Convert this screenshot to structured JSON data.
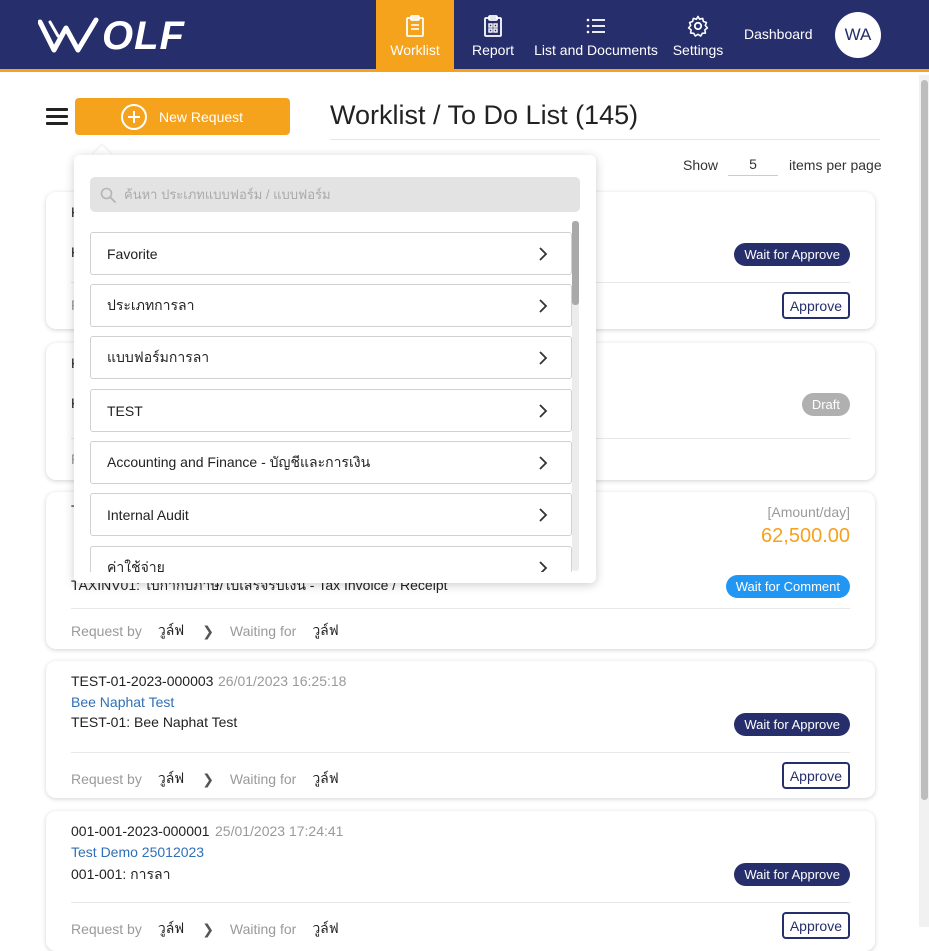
{
  "app": {
    "logo_text": "OLF",
    "logo_alt": "WOLF"
  },
  "nav": {
    "items": [
      {
        "label": "Worklist"
      },
      {
        "label": "Report"
      },
      {
        "label": "List and Documents"
      },
      {
        "label": "Settings"
      }
    ],
    "dashboard": "Dashboard",
    "avatar_initials": "WA"
  },
  "toolbar": {
    "new_request_label": "New Request"
  },
  "page": {
    "title": "Worklist / To Do List (145)",
    "show_label": "Show",
    "items_per_page": "5",
    "items_per_page_suffix": "items per page"
  },
  "dropdown": {
    "search_placeholder": "ค้นหา ประเภทแบบฟอร์ม / แบบฟอร์ม",
    "items": [
      {
        "label": "Favorite"
      },
      {
        "label": "ประเภทการลา"
      },
      {
        "label": "แบบฟอร์มการลา"
      },
      {
        "label": "TEST"
      },
      {
        "label": "Accounting and Finance - บัญชีและการเงิน"
      },
      {
        "label": "Internal Audit"
      },
      {
        "label": "ค่าใช้จ่าย"
      }
    ]
  },
  "cards": [
    {
      "doc_no": "K",
      "partial": "K",
      "foot_partial": "F",
      "status": "Wait for Approve",
      "action": "Approve"
    },
    {
      "doc_no": "K",
      "partial": "K",
      "foot_partial": "F",
      "status": "Draft"
    },
    {
      "doc_no": "T",
      "subtitle": "TAXINV01: ใบกำกับภาษี/ใบเสร็จรับเงิน - Tax Invoice / Receipt",
      "amount_label": "[Amount/day]",
      "amount": "62,500.00",
      "status": "Wait for Comment",
      "request_by_label": "Request by",
      "request_by": "วูล์ฟ",
      "waiting_for_label": "Waiting for",
      "waiting_for": "วูล์ฟ"
    },
    {
      "doc_no": "TEST-01-2023-000003",
      "date": "26/01/2023 16:25:18",
      "link": "Bee Naphat Test",
      "subtitle": "TEST-01: Bee Naphat Test",
      "status": "Wait for Approve",
      "action": "Approve",
      "request_by_label": "Request by",
      "request_by": "วูล์ฟ",
      "waiting_for_label": "Waiting for",
      "waiting_for": "วูล์ฟ"
    },
    {
      "doc_no": "001-001-2023-000001",
      "date": "25/01/2023 17:24:41",
      "link": "Test Demo 25012023",
      "subtitle": "001-001: การลา",
      "status": "Wait for Approve",
      "action": "Approve",
      "request_by_label": "Request by",
      "request_by": "วูล์ฟ",
      "waiting_for_label": "Waiting for",
      "waiting_for": "วูล์ฟ"
    }
  ],
  "colors": {
    "brand_navy": "#262e6c",
    "brand_orange": "#f5a21c",
    "link_blue": "#2f6fb7",
    "comment_blue": "#2196f3",
    "draft_gray": "#b0b0b0"
  }
}
